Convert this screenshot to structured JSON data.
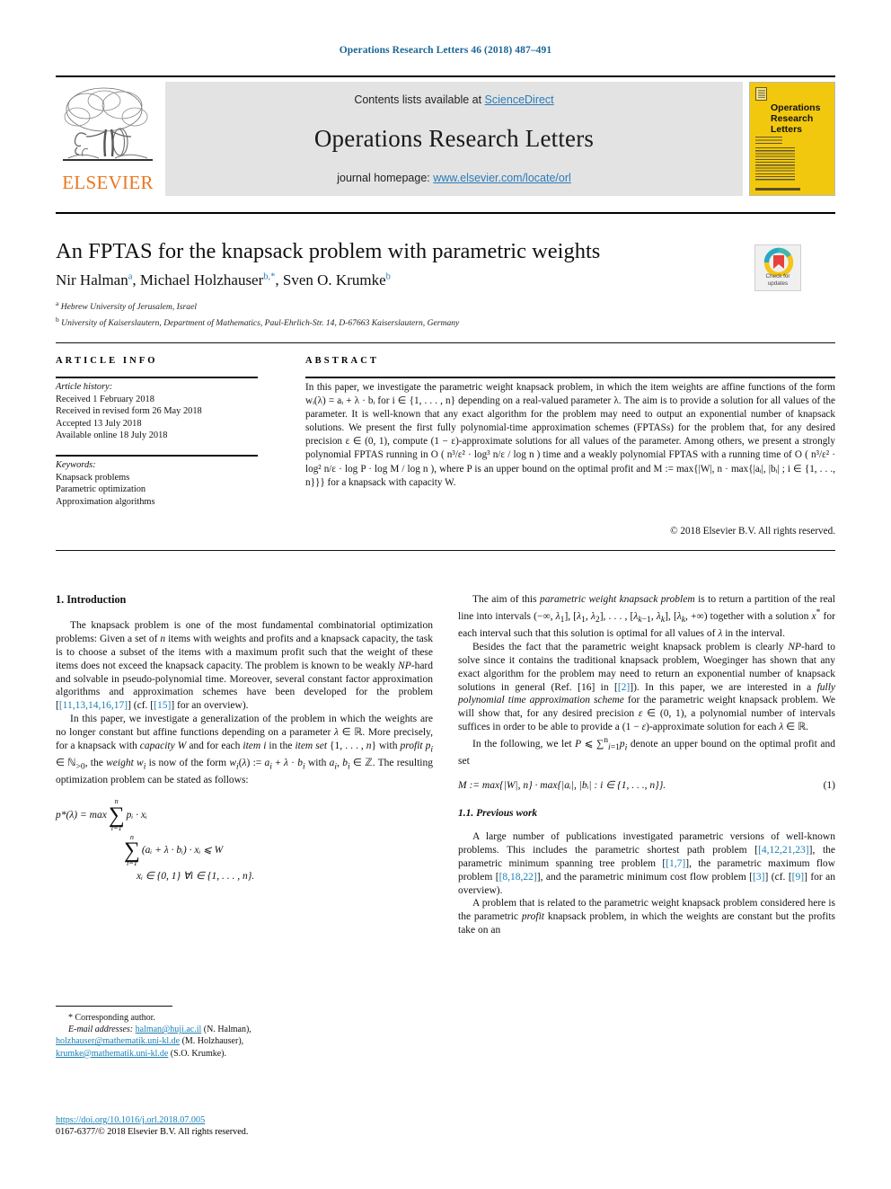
{
  "running_head": "Operations Research Letters 46 (2018) 487–491",
  "masthead": {
    "publisher_name": "ELSEVIER",
    "contents_prefix": "Contents lists available at ",
    "contents_link": "ScienceDirect",
    "journal_title": "Operations Research Letters",
    "homepage_prefix": "journal homepage: ",
    "homepage_link": "www.elsevier.com/locate/orl",
    "cover_title_line1": "Operations",
    "cover_title_line2": "Research",
    "cover_title_line3": "Letters"
  },
  "crossmark": {
    "line1": "Check for",
    "line2": "updates"
  },
  "article": {
    "title": "An FPTAS for the knapsack problem with parametric weights",
    "authors_plain": "Nir Halman a, Michael Holzhauser b,*, Sven O. Krumke b",
    "author1": "Nir Halman",
    "author1_sup": "a",
    "author2": "Michael Holzhauser",
    "author2_sup": "b,*",
    "author3": "Sven O. Krumke",
    "author3_sup": "b",
    "affiliation_a_sup": "a",
    "affiliation_a": "Hebrew University of Jerusalem, Israel",
    "affiliation_b_sup": "b",
    "affiliation_b": "University of Kaiserslautern, Department of Mathematics, Paul-Ehrlich-Str. 14, D-67663 Kaiserslautern, Germany"
  },
  "info": {
    "heading": "ARTICLE INFO",
    "history_label": "Article history:",
    "history": [
      "Received 1 February 2018",
      "Received in revised form 26 May 2018",
      "Accepted 13 July 2018",
      "Available online 18 July 2018"
    ],
    "keywords_label": "Keywords:",
    "keywords": [
      "Knapsack problems",
      "Parametric optimization",
      "Approximation algorithms"
    ]
  },
  "abstract": {
    "heading": "ABSTRACT",
    "p1": "In this paper, we investigate the parametric weight knapsack problem, in which the item weights are affine functions of the form wᵢ(λ) = aᵢ + λ · bᵢ for i ∈ {1, . . . , n} depending on a real-valued parameter λ. The aim is to provide a solution for all values of the parameter. It is well-known that any exact algorithm for the problem may need to output an exponential number of knapsack solutions. We present the first fully polynomial-time approximation schemes (FPTASs) for the problem that, for any desired precision ε ∈ (0, 1), compute (1 − ε)-approximate solutions for all values of the parameter. Among others, we present a strongly polynomial FPTAS running in O ( n³/ε² · log³ n/ε / log n ) time and a weakly polynomial FPTAS with a running time of O ( n³/ε² · log² n/ε · log P · log M / log n ), where P is an upper bound on the optimal profit and M := max{|W|, n · max{|aᵢ|, |bᵢ| ; i ∈ {1, . . ., n}}} for a knapsack with capacity W.",
    "copyright": "© 2018 Elsevier B.V. All rights reserved."
  },
  "body": {
    "section1_heading": "1. Introduction",
    "left_p1": "The knapsack problem is one of the most fundamental combinatorial optimization problems: Given a set of n items with weights and profits and a knapsack capacity, the task is to choose a subset of the items with a maximum profit such that the weight of these items does not exceed the knapsack capacity. The problem is known to be weakly NP-hard and solvable in pseudo-polynomial time. Moreover, several constant factor approximation algorithms and approximation schemes have been developed for the problem [11,13,14,16,17] (cf. [15] for an overview).",
    "left_p1_refs": "[11,13,14,16,17]",
    "left_p1_ref2": "[15]",
    "left_p2": "In this paper, we investigate a generalization of the problem in which the weights are no longer constant but affine functions depending on a parameter λ ∈ ℝ. More precisely, for a knapsack with capacity W and for each item i in the item set {1, . . . , n} with profit pᵢ ∈ ℕ>0, the weight wᵢ is now of the form wᵢ(λ) := aᵢ + λ · bᵢ with aᵢ, bᵢ ∈ ℤ. The resulting optimization problem can be stated as follows:",
    "math_line1": "p*(λ) = max",
    "math_sum_upper": "n",
    "math_sum_lower": "i=1",
    "math_obj": "pᵢ · xᵢ",
    "math_constraint": "(aᵢ + λ · bᵢ) · xᵢ ⩽ W",
    "math_domain": "xᵢ ∈ {0, 1}   ∀i ∈ {1, . . . , n}.",
    "right_p1": "The aim of this parametric weight knapsack problem is to return a partition of the real line into intervals (−∞, λ₁], [λ₁, λ₂], . . . , [λ_{k−1}, λ_k], [λ_k, +∞) together with a solution x* for each interval such that this solution is optimal for all values of λ in the interval.",
    "right_p2": "Besides the fact that the parametric weight knapsack problem is clearly NP-hard to solve since it contains the traditional knapsack problem, Woeginger has shown that any exact algorithm for the problem may need to return an exponential number of knapsack solutions in general (Ref. [16] in [2]). In this paper, we are interested in a fully polynomial time approximation scheme for the parametric weight knapsack problem. We will show that, for any desired precision ε ∈ (0, 1), a polynomial number of intervals suffices in order to be able to provide a (1 − ε)-approximate solution for each λ ∈ ℝ.",
    "right_p2_ref": "[2]",
    "right_p3": "In the following, we let P ⩽ ∑ⁿᵢ₌₁ pᵢ denote an upper bound on the optimal profit and set",
    "equation1": "M := max{|W|, n} · max{|aᵢ|, |bᵢ| : i ∈ {1, . . ., n}}.",
    "equation1_number": "(1)",
    "subsection_heading": "1.1. Previous work",
    "right_p4": "A large number of publications investigated parametric versions of well-known problems. This includes the parametric shortest path problem [4,12,21,23], the parametric minimum spanning tree problem [1,7], the parametric maximum flow problem [8,18,22], and the parametric minimum cost flow problem [3] (cf. [9] for an overview).",
    "right_p4_ref1": "[4,12,21,23]",
    "right_p4_ref2": "[1,7]",
    "right_p4_ref3": "[8,18,22]",
    "right_p4_ref4": "[3]",
    "right_p4_ref5": "[9]",
    "right_p5": "A problem that is related to the parametric weight knapsack problem considered here is the parametric profit knapsack problem, in which the weights are constant but the profits take on an"
  },
  "footnotes": {
    "corresponding": "* Corresponding author.",
    "email_label": "E-mail addresses:",
    "email1": "halman@huji.ac.il",
    "email1_owner": "(N. Halman),",
    "email2": "holzhauser@mathematik.uni-kl.de",
    "email2_owner": "(M. Holzhauser),",
    "email3": "krumke@mathematik.uni-kl.de",
    "email3_owner": "(S.O. Krumke).",
    "doi": "https://doi.org/10.1016/j.orl.2018.07.005",
    "issn_copyright": "0167-6377/© 2018 Elsevier B.V. All rights reserved."
  },
  "colors": {
    "link_blue": "#1a7fb5",
    "sciencedirect_blue": "#2b7bb9",
    "elsevier_orange": "#E87722",
    "cover_yellow": "#f2c80f",
    "band_grey": "#e3e3e3"
  }
}
